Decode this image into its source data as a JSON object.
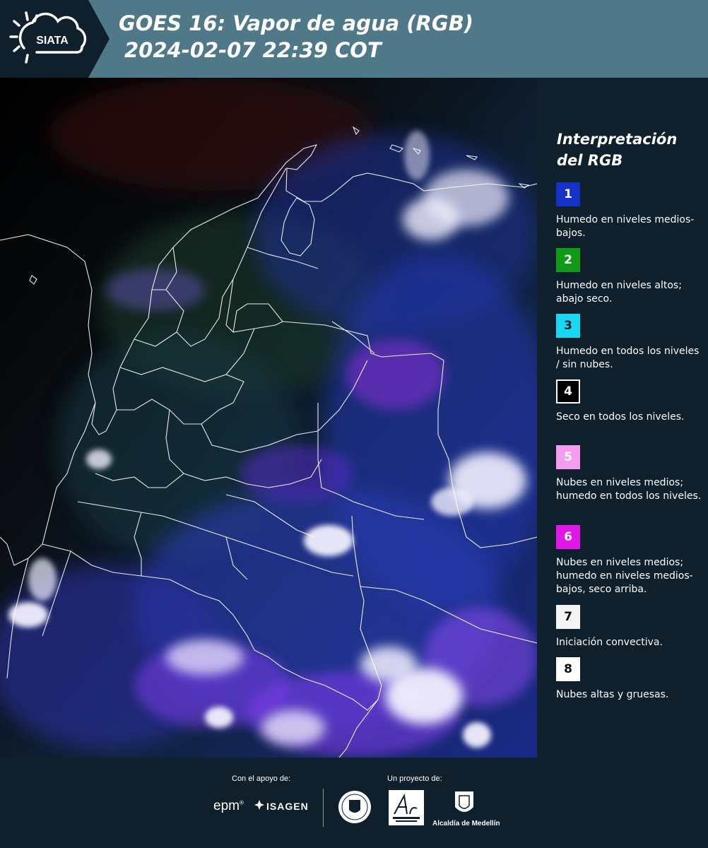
{
  "header": {
    "logo_text": "SIATA",
    "title_line1": "GOES 16: Vapor de agua (RGB)",
    "title_line2": "2024-02-07 22:39 COT"
  },
  "legend": {
    "title_line1": "Interpretación",
    "title_line2": "del RGB",
    "items": [
      {
        "number": "1",
        "color": "#1432c8",
        "text_color": "#ffffff",
        "text": "Humedo en niveles medios-bajos."
      },
      {
        "number": "2",
        "color": "#0f9a17",
        "text_color": "#ffffff",
        "text": "Humedo en niveles altos; abajo seco."
      },
      {
        "number": "3",
        "color": "#18d8ef",
        "text_color": "#0f1f2b",
        "text": "Humedo en todos los niveles / sin nubes."
      },
      {
        "number": "4",
        "color": "#000000",
        "text_color": "#ffffff",
        "text": "Seco en todos los niveles."
      },
      {
        "number": "5",
        "color": "#f59cf0",
        "text_color": "#ffffff",
        "text": "Nubes en niveles medios; humedo en todos los niveles."
      },
      {
        "number": "6",
        "color": "#e016e8",
        "text_color": "#ffffff",
        "text": "Nubes en niveles medios; humedo en niveles medios-bajos, seco arriba."
      },
      {
        "number": "7",
        "color": "#f4f4f4",
        "text_color": "#111111",
        "text": "Iniciación convectiva."
      },
      {
        "number": "8",
        "color": "#ffffff",
        "text_color": "#111111",
        "text": "Nubes altas y gruesas."
      }
    ]
  },
  "footer": {
    "support_label": "Con el apoyo de:",
    "project_label": "Un proyecto de:",
    "epm_text": "epm",
    "isagen_text": "ISAGEN",
    "alcaldia_text": "Alcaldía de Medellín"
  }
}
